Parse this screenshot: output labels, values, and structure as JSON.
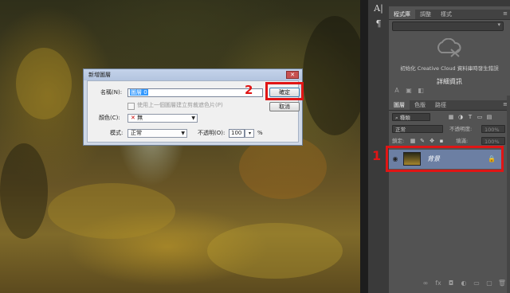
{
  "dialog": {
    "title": "新增圖層",
    "close_glyph": "✕",
    "name_label": "名稱(N):",
    "name_value": "圖層 0",
    "use_previous_label": "使用上一個圖層建立剪裁遮色片(P)",
    "color_label": "顏色(C):",
    "color_value": "無",
    "color_swatch_glyph": "✕",
    "mode_label": "模式:",
    "mode_value": "正常",
    "opacity_label": "不透明(O):",
    "opacity_value": "100",
    "opacity_unit": "%",
    "ok_label": "確定",
    "cancel_label": "取消"
  },
  "tools": {
    "char_icon": "A|",
    "para_icon": "¶"
  },
  "library": {
    "tabs": [
      "程式庫",
      "調整",
      "樣式"
    ],
    "menu_glyph": "≡",
    "cc_message": "初始化 Creative Cloud 資料庫時發生錯誤",
    "details_title": "詳細資訊"
  },
  "layers": {
    "tabs": [
      "圖層",
      "色版",
      "路徑"
    ],
    "menu_glyph": "≡",
    "filter_value": "種類",
    "blend_mode": "正常",
    "opacity_label": "不透明度:",
    "opacity_value": "100%",
    "lock_label": "鎖定:",
    "fill_label": "填滿:",
    "fill_value": "100%",
    "items": [
      {
        "name": "背景",
        "visible": true,
        "locked": true
      }
    ]
  },
  "annotations": {
    "marker_1": "1",
    "marker_2": "2",
    "color": "#e01515"
  }
}
